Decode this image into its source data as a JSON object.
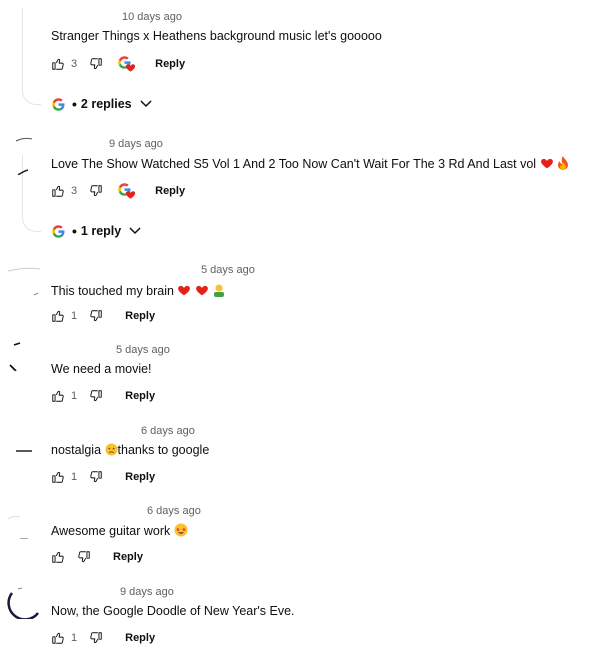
{
  "comments": [
    {
      "time": "10 days ago",
      "text": "Stranger Things x Heathens background music let's gooooo",
      "likes": "3",
      "reply_label": "Reply",
      "replies_label": "2 replies"
    },
    {
      "time": "9 days ago",
      "text": "Love The Show Watched S5 Vol 1 And 2 Too Now Can't Wait For The 3 Rd And Last vol",
      "likes": "3",
      "reply_label": "Reply",
      "replies_label": "1 reply"
    },
    {
      "time": "5 days ago",
      "text": "This touched my brain",
      "likes": "1",
      "reply_label": "Reply"
    },
    {
      "time": "5 days ago",
      "text": "We need a movie!",
      "likes": "1",
      "reply_label": "Reply"
    },
    {
      "time": "6 days ago",
      "text_before": "nostalgia",
      "text_after": "thanks to google",
      "likes": "1",
      "reply_label": "Reply"
    },
    {
      "time": "6 days ago",
      "text": "Awesome guitar work",
      "likes": "",
      "reply_label": "Reply"
    },
    {
      "time": "9 days ago",
      "text": "Now, the Google Doodle of New Year's Eve.",
      "likes": "1",
      "reply_label": "Reply"
    }
  ],
  "icons": {
    "like": "thumbs-up-icon",
    "dislike": "thumbs-down-icon",
    "creator_heart": "google-heart-icon",
    "expand": "chevron-down-icon",
    "google": "google-g-icon"
  },
  "colors": {
    "heart_red": "#e62117",
    "google_blue": "#4285f4",
    "google_red": "#ea4335",
    "google_yellow": "#fbbc05",
    "google_green": "#34a853"
  }
}
